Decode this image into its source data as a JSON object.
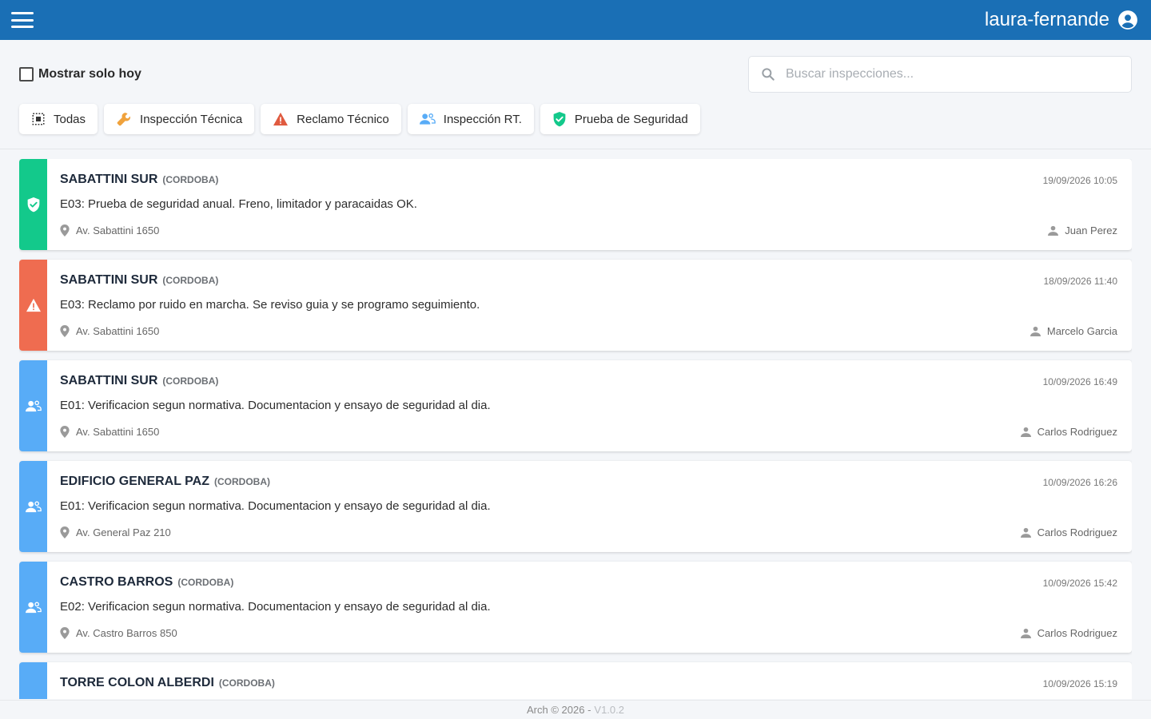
{
  "header": {
    "username": "laura-fernande",
    "color": "#1a6fb5"
  },
  "filters_bar": {
    "today_only_label": "Mostrar solo hoy",
    "today_only_checked": false,
    "search_placeholder": "Buscar inspecciones...",
    "search_value": "",
    "chips": [
      {
        "label": "Todas",
        "icon": "select-all-icon"
      },
      {
        "label": "Inspección Técnica",
        "icon": "wrench-icon"
      },
      {
        "label": "Reclamo Técnico",
        "icon": "warning-icon"
      },
      {
        "label": "Inspección RT.",
        "icon": "people-icon"
      },
      {
        "label": "Prueba de Seguridad",
        "icon": "shield-check-icon"
      }
    ]
  },
  "type_colors": {
    "seguridad": "#13c98b",
    "reclamo": "#ef6c50",
    "rt": "#58acf7",
    "tecnica": "#f0a23c"
  },
  "inspections": [
    {
      "name": "SABATTINI SUR",
      "province": "(CORDOBA)",
      "datetime": "19/09/2026 10:05",
      "description": "E03: Prueba de seguridad anual. Freno, limitador y paracaidas OK.",
      "address": "Av. Sabattini 1650",
      "inspector": "Juan Perez",
      "type": "seguridad"
    },
    {
      "name": "SABATTINI SUR",
      "province": "(CORDOBA)",
      "datetime": "18/09/2026 11:40",
      "description": "E03: Reclamo por ruido en marcha. Se reviso guia y se programo seguimiento.",
      "address": "Av. Sabattini 1650",
      "inspector": "Marcelo Garcia",
      "type": "reclamo"
    },
    {
      "name": "SABATTINI SUR",
      "province": "(CORDOBA)",
      "datetime": "10/09/2026 16:49",
      "description": "E01: Verificacion segun normativa. Documentacion y ensayo de seguridad al dia.",
      "address": "Av. Sabattini 1650",
      "inspector": "Carlos Rodriguez",
      "type": "rt"
    },
    {
      "name": "EDIFICIO GENERAL PAZ",
      "province": "(CORDOBA)",
      "datetime": "10/09/2026 16:26",
      "description": "E01: Verificacion segun normativa. Documentacion y ensayo de seguridad al dia.",
      "address": "Av. General Paz 210",
      "inspector": "Carlos Rodriguez",
      "type": "rt"
    },
    {
      "name": "CASTRO BARROS",
      "province": "(CORDOBA)",
      "datetime": "10/09/2026 15:42",
      "description": "E02: Verificacion segun normativa. Documentacion y ensayo de seguridad al dia.",
      "address": "Av. Castro Barros 850",
      "inspector": "Carlos Rodriguez",
      "type": "rt"
    },
    {
      "name": "TORRE COLON ALBERDI",
      "province": "(CORDOBA)",
      "datetime": "10/09/2026 15:19",
      "description": "",
      "address": "",
      "inspector": "",
      "type": "rt"
    }
  ],
  "footer": {
    "copyright": "Arch © 2026 -",
    "version": "V1.0.2"
  }
}
